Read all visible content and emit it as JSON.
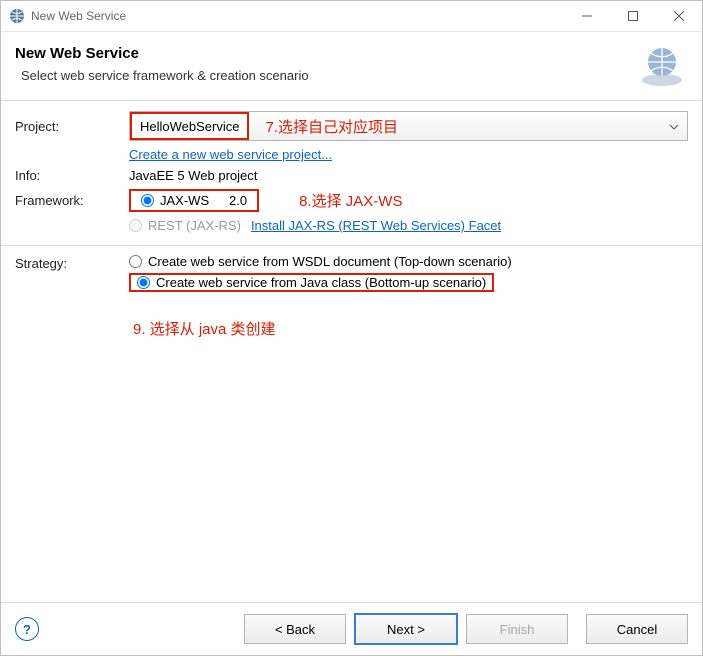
{
  "titlebar": {
    "text": "New Web Service"
  },
  "banner": {
    "heading": "New Web Service",
    "sub": "Select web service framework & creation scenario"
  },
  "labels": {
    "project": "Project:",
    "info": "Info:",
    "framework": "Framework:",
    "strategy": "Strategy:"
  },
  "project": {
    "selected": "HelloWebService",
    "create_link": "Create a new web service project..."
  },
  "info": {
    "text": "JavaEE 5 Web project"
  },
  "framework": {
    "jaxws": {
      "label": "JAX-WS",
      "version": "2.0"
    },
    "rest": {
      "label": "REST (JAX-RS)",
      "install_link": "Install JAX-RS (REST Web Services) Facet"
    }
  },
  "strategy": {
    "top": "Create web service from WSDL document (Top-down scenario)",
    "bottom": "Create web service from Java class (Bottom-up scenario)"
  },
  "annot": {
    "a7": "7.选择自己对应项目",
    "a8": "8.选择 JAX-WS",
    "a9": "9. 选择从 java 类创建"
  },
  "buttons": {
    "back": "< Back",
    "next": "Next >",
    "finish": "Finish",
    "cancel": "Cancel"
  }
}
